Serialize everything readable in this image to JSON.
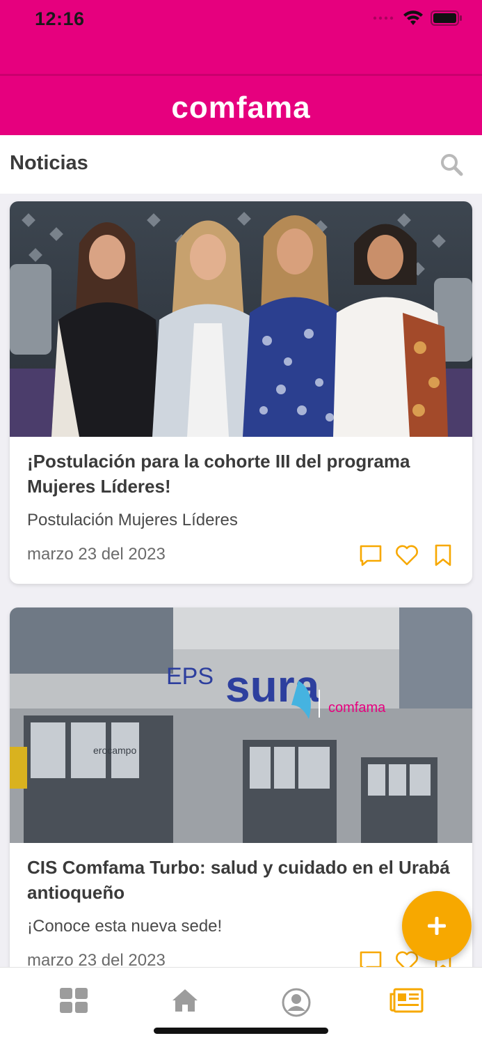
{
  "status_bar": {
    "time": "12:16"
  },
  "brand": {
    "name": "comfama",
    "color": "#e6007e"
  },
  "page": {
    "title": "Noticias"
  },
  "colors": {
    "accent": "#f7a800",
    "brand": "#e6007e"
  },
  "news": [
    {
      "title": "¡Postulación para la cohorte III del programa Mujeres Líderes!",
      "subtitle": "Postulación Mujeres Líderes",
      "date": "marzo 23 del 2023",
      "image_signage": ""
    },
    {
      "title": "CIS Comfama Turbo: salud y cuidado en el Urabá antioqueño",
      "subtitle": "¡Conoce esta nueva sede!",
      "date": "marzo 23 del 2023",
      "image_signage": {
        "eps": "EPS",
        "sura": "sura",
        "comfama": "comfama",
        "store": "erocampo"
      }
    }
  ],
  "icons": {
    "search": "search-icon",
    "comment": "comment-icon",
    "like": "heart-icon",
    "save": "bookmark-icon",
    "add": "plus-icon",
    "tabs": [
      "grid-icon",
      "home-icon",
      "profile-icon",
      "newspaper-icon"
    ]
  },
  "tabbar": {
    "active_index": 3
  }
}
